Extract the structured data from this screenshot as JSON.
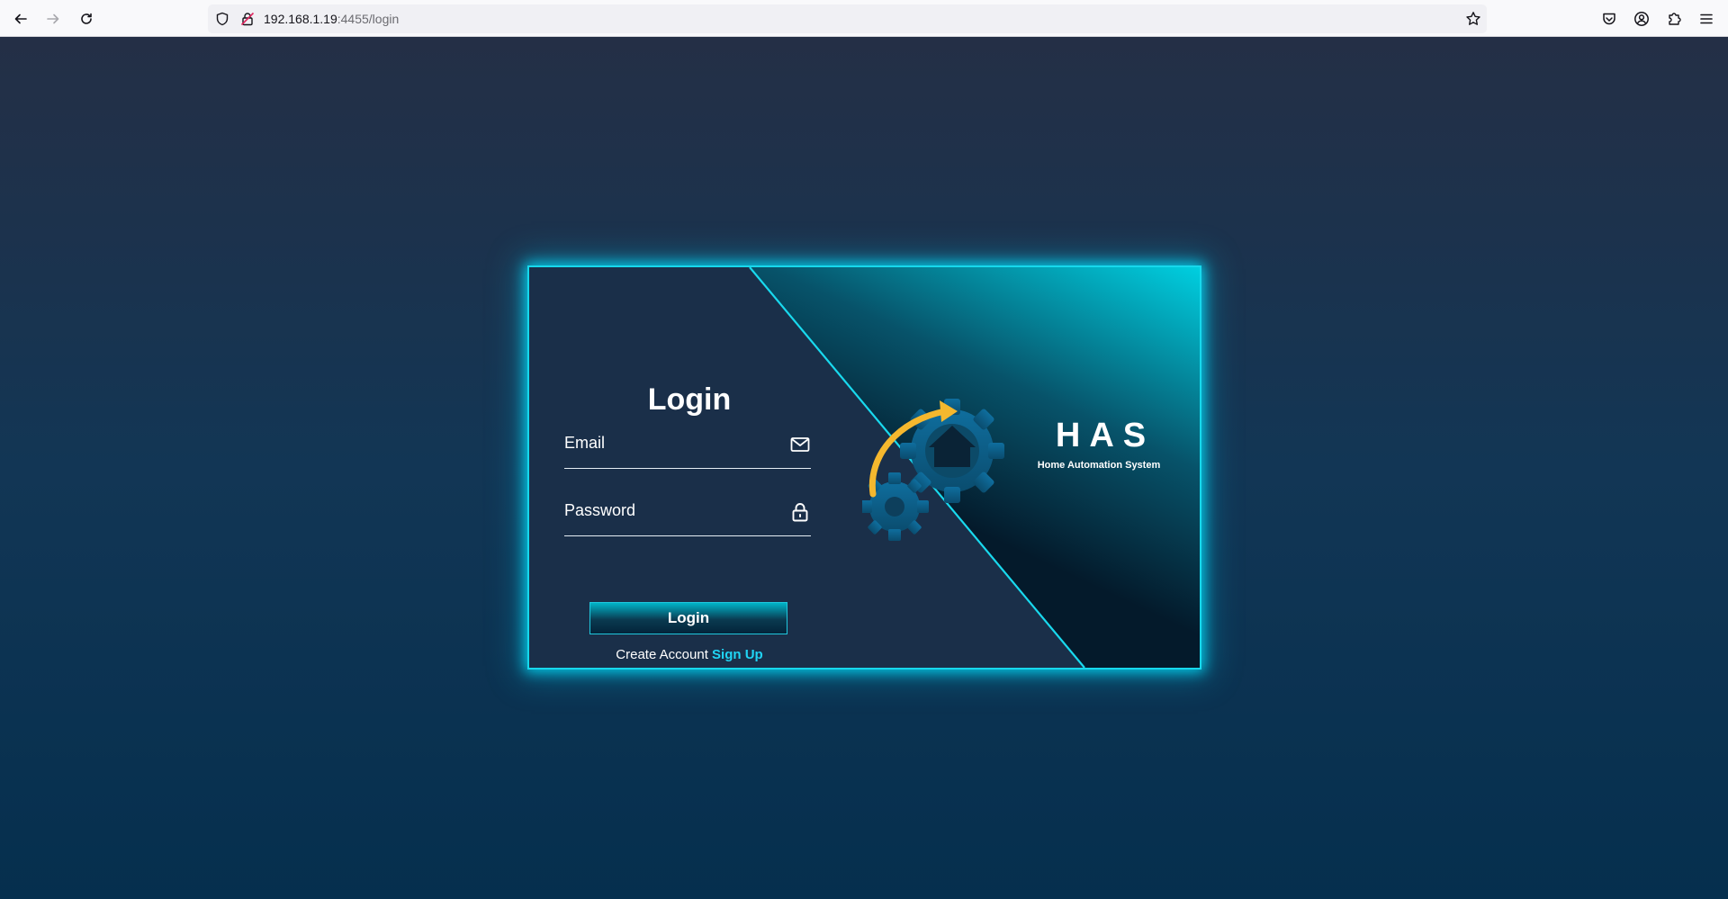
{
  "browser": {
    "url_host": "192.168.1.19",
    "url_path": ":4455/login"
  },
  "login": {
    "title": "Login",
    "email_placeholder": "Email",
    "password_placeholder": "Password",
    "button_label": "Login",
    "create_account_text": "Create Account",
    "signup_link": "Sign Up"
  },
  "brand": {
    "name": "HAS",
    "tagline": "Home Automation System"
  },
  "colors": {
    "neon_border": "#17d8ec",
    "link": "#20d4f4",
    "arrow": "#f5b82e",
    "gear": "#0e5f8a"
  }
}
